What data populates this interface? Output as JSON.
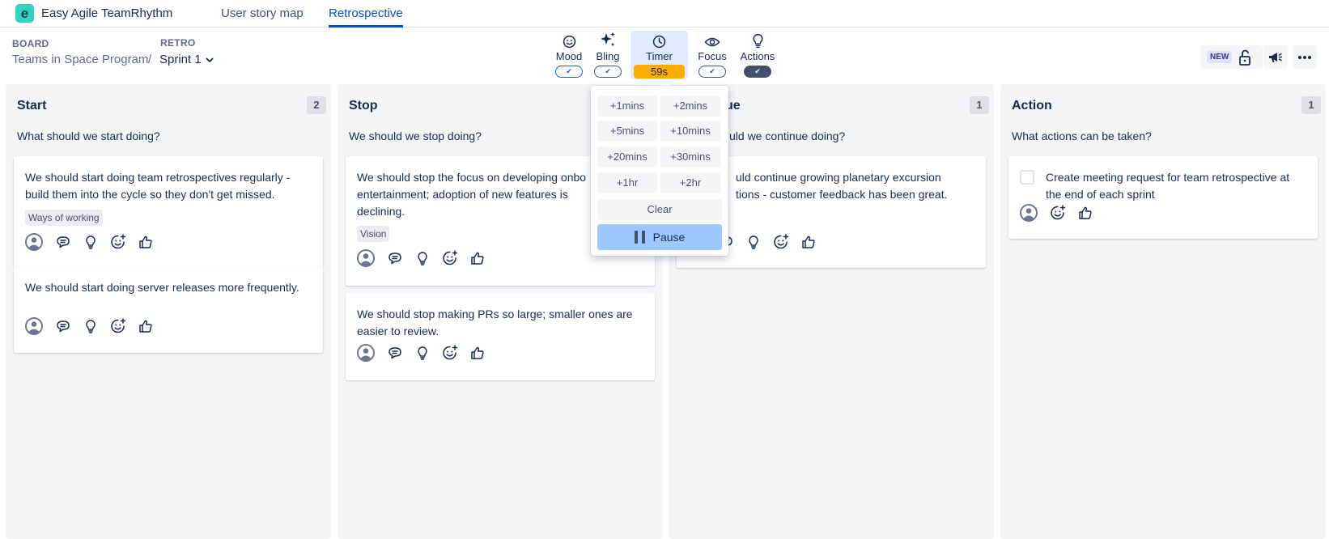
{
  "app": {
    "name": "Easy Agile TeamRhythm",
    "logo_letter": "e",
    "tabs": [
      {
        "label": "User story map",
        "active": false
      },
      {
        "label": "Retrospective",
        "active": true
      }
    ]
  },
  "breadcrumb": {
    "board_label": "BOARD",
    "board_value": "Teams in Space Program",
    "separator": "/",
    "retro_label": "RETRO",
    "retro_value": "Sprint 1"
  },
  "toolbar": {
    "mood": {
      "label": "Mood",
      "toggle": "✔",
      "icon": "smiley-icon"
    },
    "bling": {
      "label": "Bling",
      "toggle": "✔",
      "icon": "sparkle-icon"
    },
    "timer": {
      "label": "Timer",
      "value": "59s",
      "icon": "clock-icon"
    },
    "focus": {
      "label": "Focus",
      "toggle": "✔",
      "icon": "eye-icon"
    },
    "actions": {
      "label": "Actions",
      "toggle": "✔",
      "icon": "lightbulb-icon"
    }
  },
  "header_buttons": {
    "new_label": "NEW"
  },
  "columns": [
    {
      "title": "Start",
      "count": "2",
      "question": "What should we start doing?",
      "cards": [
        {
          "text": "We should start doing team retrospectives regularly - build them into the cycle so they don't get missed.",
          "tag": "Ways of working"
        },
        {
          "text": "We should start doing server releases more frequently.",
          "tag": ""
        }
      ]
    },
    {
      "title": "Stop",
      "count": "",
      "question": "We should we stop doing?",
      "cards": [
        {
          "text": "We should stop the focus on developing onbo",
          "text2": "entertainment; adoption of new features is",
          "text3": "declining.",
          "tag": "Vision"
        },
        {
          "text": "We should stop making PRs so large; smaller ones are easier to review.",
          "tag": ""
        }
      ]
    },
    {
      "title": "ue",
      "count": "1",
      "question": "uld we continue doing?",
      "cards": [
        {
          "text": "uld continue growing planetary excursion",
          "text2": "tions - customer feedback has been great.",
          "tag": ""
        }
      ]
    },
    {
      "title": "Action",
      "count": "1",
      "question": "What actions can be taken?",
      "cards": [
        {
          "text": "Create meeting request for team retrospective at the end of each sprint",
          "tag": ""
        }
      ]
    }
  ],
  "timer_popover": {
    "options": [
      "+1mins",
      "+2mins",
      "+5mins",
      "+10mins",
      "+20mins",
      "+30mins",
      "+1hr",
      "+2hr"
    ],
    "clear_label": "Clear",
    "pause_label": "Pause"
  },
  "colors": {
    "accent": "#0052cc",
    "timer_badge": "#ffab00",
    "pause_button": "#9cc7ff",
    "logo": "#2fd3c0",
    "column_bg": "#f4f5f7"
  }
}
